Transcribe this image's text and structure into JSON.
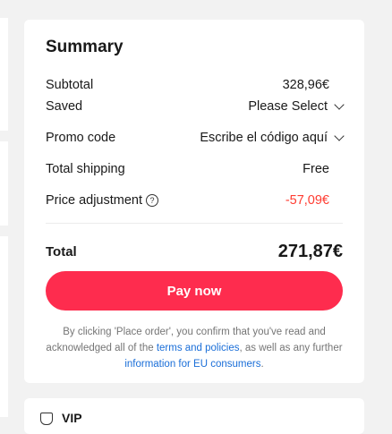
{
  "summary": {
    "title": "Summary",
    "subtotal": {
      "label": "Subtotal",
      "value": "328,96€"
    },
    "saved": {
      "label": "Saved",
      "value": "Please Select"
    },
    "promo_code": {
      "label": "Promo code",
      "value": "Escribe el código aquí"
    },
    "total_shipping": {
      "label": "Total shipping",
      "value": "Free"
    },
    "price_adjustment": {
      "label": "Price adjustment",
      "help": "?",
      "value": "-57,09€"
    },
    "total": {
      "label": "Total",
      "value": "271,87€"
    },
    "pay_button_label": "Pay now",
    "disclaimer": {
      "part1": "By clicking 'Place order', you confirm that you've read and acknowledged all of the ",
      "terms_link": "terms and policies",
      "part2": ", as well as any further ",
      "eu_link": "information for EU consumers",
      "part3": "."
    }
  },
  "bottom_card": {
    "text": "VIP"
  },
  "colors": {
    "accent": "#fe2c4e",
    "negative": "#ff3b30",
    "link": "#1a6ed8",
    "page_background": "#f2f2f2"
  },
  "icons": {
    "dropdown": "chevron-down-icon",
    "help": "help-circle-icon",
    "bottom_card": "shield-icon"
  }
}
